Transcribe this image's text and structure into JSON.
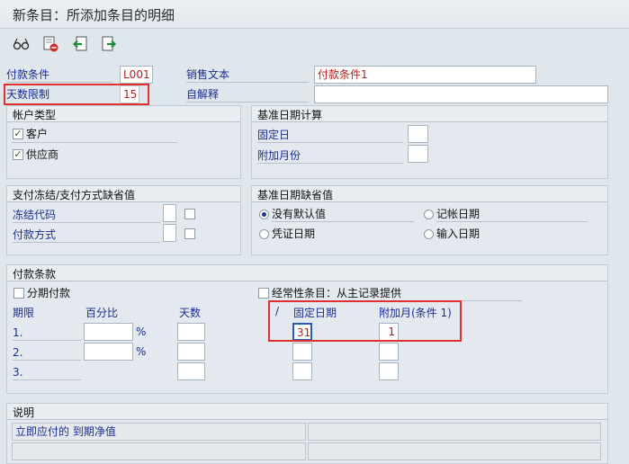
{
  "title": "新条目：所添加条目的明细",
  "toolbar": {
    "icons": [
      "glasses-icon",
      "delete-icon",
      "previous-entry-icon",
      "next-entry-icon"
    ]
  },
  "top": {
    "payment_term_label": "付款条件",
    "payment_term_value": "L001",
    "sales_text_label": "销售文本",
    "sales_text_value": "付款条件1",
    "day_limit_label": "天数限制",
    "day_limit_value": "15",
    "own_explanation_label": "自解释",
    "own_explanation_value": ""
  },
  "account_type": {
    "title": "帐户类型",
    "customer_label": "客户",
    "customer_checked": true,
    "vendor_label": "供应商",
    "vendor_checked": true
  },
  "baseline_calc": {
    "title": "基准日期计算",
    "fixed_day_label": "固定日",
    "extra_months_label": "附加月份"
  },
  "block_payment": {
    "title": "支付冻结/支付方式缺省值",
    "block_key_label": "冻结代码",
    "payment_method_label": "付款方式"
  },
  "baseline_default": {
    "title": "基准日期缺省值",
    "options": [
      {
        "label": "没有默认值",
        "selected": true
      },
      {
        "label": "记帐日期",
        "selected": false
      },
      {
        "label": "凭证日期",
        "selected": false
      },
      {
        "label": "输入日期",
        "selected": false
      }
    ]
  },
  "terms": {
    "title": "付款条款",
    "installment_label": "分期付款",
    "recurring_label": "经常性条目：从主记录提供",
    "col_term": "期限",
    "col_percent": "百分比",
    "col_days": "天数",
    "col_slash": "/",
    "col_fixed_date": "固定日期",
    "col_extra_month": "附加月(条件 1)",
    "percent_sign": "%",
    "rows": [
      {
        "label": "1.",
        "fixed_date": "31",
        "extra_month": "1"
      },
      {
        "label": "2.",
        "fixed_date": "",
        "extra_month": ""
      },
      {
        "label": "3.",
        "fixed_date": "",
        "extra_month": ""
      }
    ]
  },
  "explanation": {
    "title": "说明",
    "line1": "立即应付的 到期净值"
  }
}
